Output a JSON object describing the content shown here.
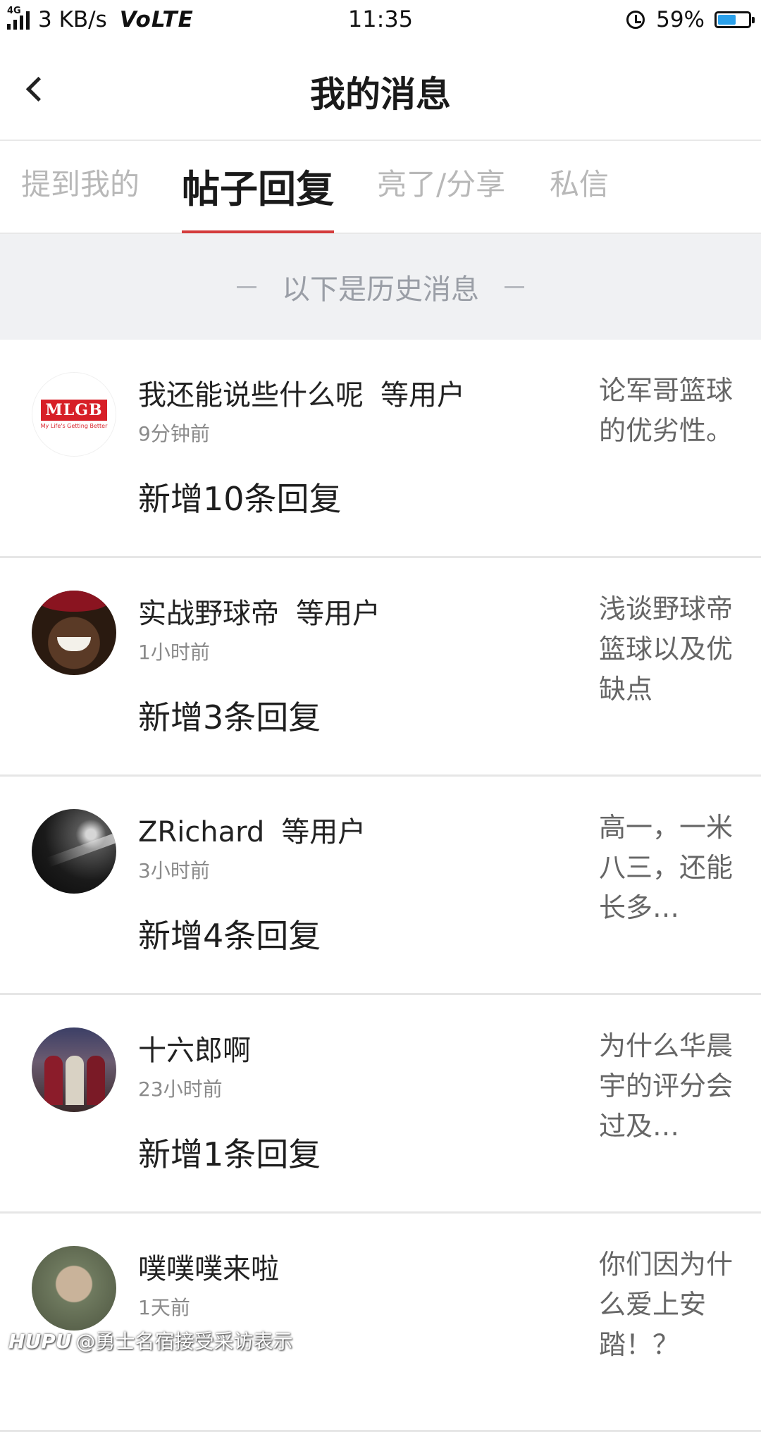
{
  "status_bar": {
    "network": "4G",
    "speed": "3 KB/s",
    "volte": "VoLTE",
    "time": "11:35",
    "battery": "59%",
    "battery_level": 0.59
  },
  "header": {
    "title": "我的消息"
  },
  "tabs": [
    {
      "label": "提到我的",
      "active": false
    },
    {
      "label": "帖子回复",
      "active": true
    },
    {
      "label": "亮了/分享",
      "active": false
    },
    {
      "label": "私信",
      "active": false
    }
  ],
  "history_label": "以下是历史消息",
  "messages": [
    {
      "user": "我还能说些什么呢",
      "suffix": "等用户",
      "time": "9分钟前",
      "count_text": "新增10条回复",
      "post": "论军哥篮球的优劣性。",
      "avatar": "mlgb-logo",
      "avatar_text": "MLGB",
      "avatar_sub": "My Life's Getting Better"
    },
    {
      "user": "实战野球帝",
      "suffix": "等用户",
      "time": "1小时前",
      "count_text": "新增3条回复",
      "post": "浅谈野球帝篮球以及优缺点",
      "avatar": "smiling-man"
    },
    {
      "user": "ZRichard",
      "suffix": "等用户",
      "time": "3小时前",
      "count_text": "新增4条回复",
      "post": "高一，一米八三，还能长多…",
      "avatar": "dark-stage"
    },
    {
      "user": "十六郎啊",
      "suffix": "",
      "time": "23小时前",
      "count_text": "新增1条回复",
      "post": "为什么华晨宇的评分会过及…",
      "avatar": "band-photo"
    },
    {
      "user": "噗噗噗来啦",
      "suffix": "",
      "time": "1天前",
      "count_text": "",
      "post": "你们因为什么爱上安踏！？",
      "avatar": "pointing-boy"
    }
  ],
  "watermark": {
    "brand": "HUPU",
    "text": "@勇士名宿接受采访表示"
  }
}
